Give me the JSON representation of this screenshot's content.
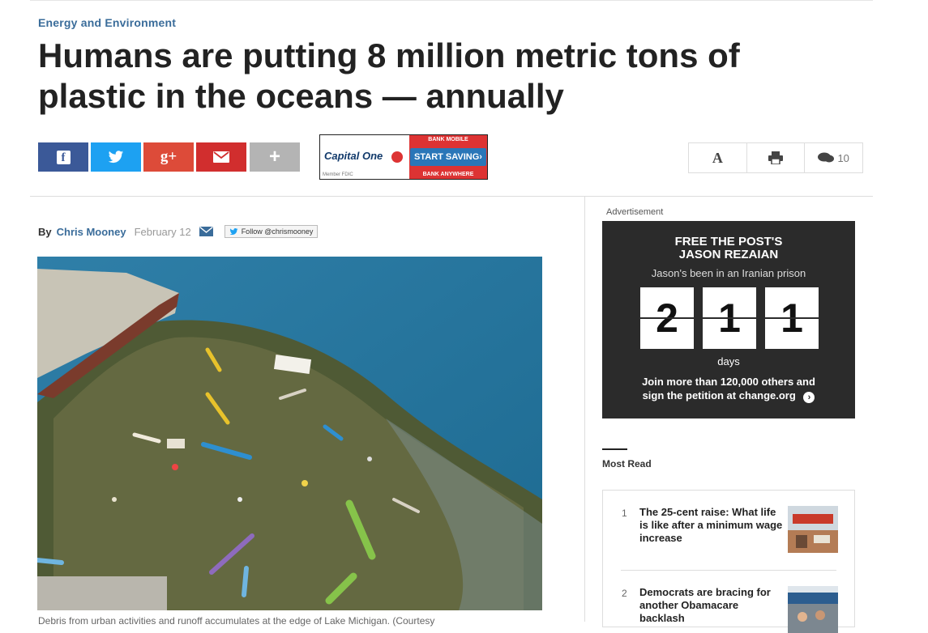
{
  "section": "Energy and Environment",
  "headline": "Humans are putting 8 million metric tons of plastic in the oceans — annually",
  "share": [
    {
      "name": "facebook",
      "icon": "f",
      "color": "#3b5998"
    },
    {
      "name": "twitter",
      "icon": "twitter-bird",
      "color": "#1da1f2"
    },
    {
      "name": "google-plus",
      "icon": "g+",
      "color": "#dd4b39"
    },
    {
      "name": "email",
      "icon": "envelope",
      "color": "#d12e2e"
    },
    {
      "name": "more",
      "icon": "+",
      "color": "#b4b4b4"
    }
  ],
  "inline_ad": {
    "logo": "Capital One",
    "fine_print": "Member FDIC",
    "top_text": "BANK MOBILE",
    "button": "START SAVING›",
    "bottom_text": "BANK ANYWHERE"
  },
  "tools": {
    "font_label": "A",
    "print_icon": "printer-icon",
    "comment_count": "10"
  },
  "byline": {
    "by": "By",
    "author": "Chris Mooney",
    "date": "February 12",
    "follow": "Follow @chrismooney"
  },
  "photo": {
    "caption": "Debris from urban activities and runoff accumulates at the edge of Lake Michigan. (Courtesy"
  },
  "ad_label": "Advertisement",
  "promo": {
    "title_line1": "FREE THE POST'S",
    "title_line2": "JASON REZAIAN",
    "subtitle": "Jason's been in an Iranian prison",
    "digits": [
      "2",
      "1",
      "1"
    ],
    "days_label": "days",
    "cta_line1": "Join more than 120,000 others and",
    "cta_line2": "sign the petition at change.org"
  },
  "most_read": {
    "title": "Most Read",
    "items": [
      {
        "num": "1",
        "text": "The 25-cent raise: What life is like after a minimum wage increase"
      },
      {
        "num": "2",
        "text": "Democrats are bracing for another Obamacare backlash"
      }
    ]
  }
}
